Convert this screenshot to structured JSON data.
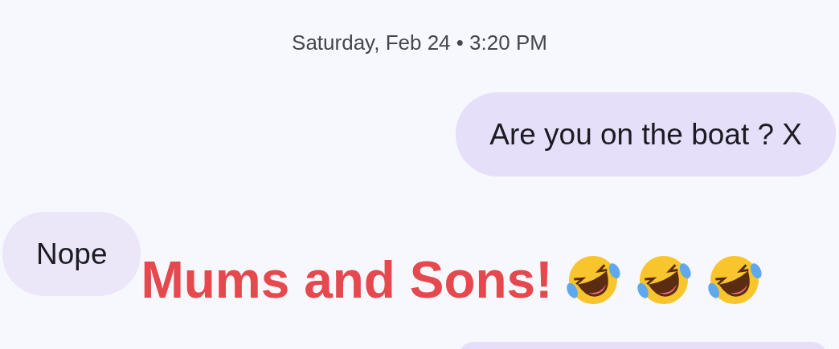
{
  "timestamp": "Saturday, Feb 24 • 3:20 PM",
  "messages": [
    {
      "kind": "sent",
      "text": "Are you on the boat ? X"
    },
    {
      "kind": "received",
      "text": "Nope"
    }
  ],
  "caption": {
    "text": "Mums and Sons!",
    "emojis": [
      {
        "kind": "laughing"
      },
      {
        "kind": "laughing"
      },
      {
        "kind": "laughing"
      }
    ]
  },
  "partial_message": {
    "kind": "sent"
  }
}
